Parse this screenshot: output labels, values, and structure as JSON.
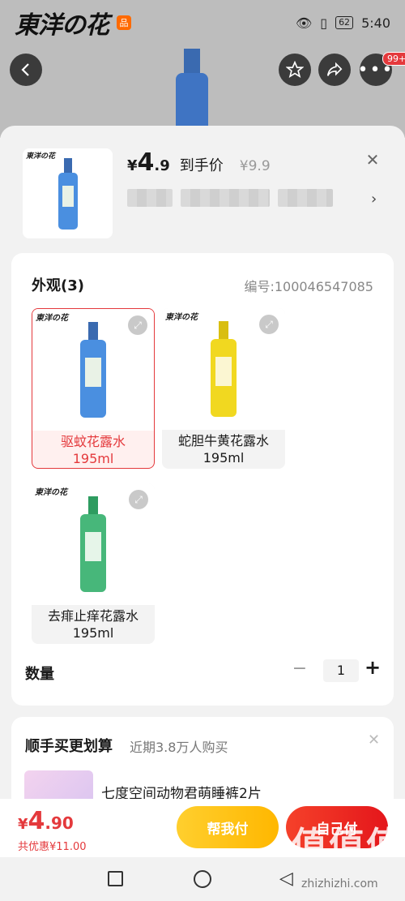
{
  "status_bar": {
    "brand": "東洋の花",
    "app_badge": "品",
    "battery": "62",
    "time": "5:40"
  },
  "header_nav": {
    "more_badge": "99+"
  },
  "sheet": {
    "thumb_logo": "東洋の花",
    "price_symbol": "¥",
    "price_int": "4",
    "price_dec": ".9",
    "price_label": "到手价",
    "original_price": "¥9.9"
  },
  "variants": {
    "title": "外观(3)",
    "sku_number": "编号:100046547085",
    "options": [
      {
        "name": "驱蚊花露水",
        "spec": "195ml",
        "logo": "東洋の花",
        "color": "#4a8fe0",
        "selected": true
      },
      {
        "name": "蛇胆牛黄花露水",
        "spec": "195ml",
        "logo": "東洋の花",
        "color": "#f1d820",
        "selected": false
      },
      {
        "name": "去痱止痒花露水",
        "spec": "195ml",
        "logo": "東洋の花",
        "color": "#47b77a",
        "selected": false
      }
    ]
  },
  "quantity": {
    "label": "数量",
    "minus": "−",
    "value": "1",
    "plus": "+"
  },
  "bundle": {
    "title": "顺手买更划算",
    "subtitle": "近期3.8万人购买",
    "item_name": "七度空间动物君萌睡裤2片"
  },
  "actionbar": {
    "symbol": "¥",
    "int": "4",
    "dec": ".90",
    "discount": "共优惠¥11.00",
    "help_pay": "帮我付",
    "self_pay": "自己付"
  },
  "watermark": {
    "text": "值值值",
    "url": "zhizhizhi.com"
  }
}
